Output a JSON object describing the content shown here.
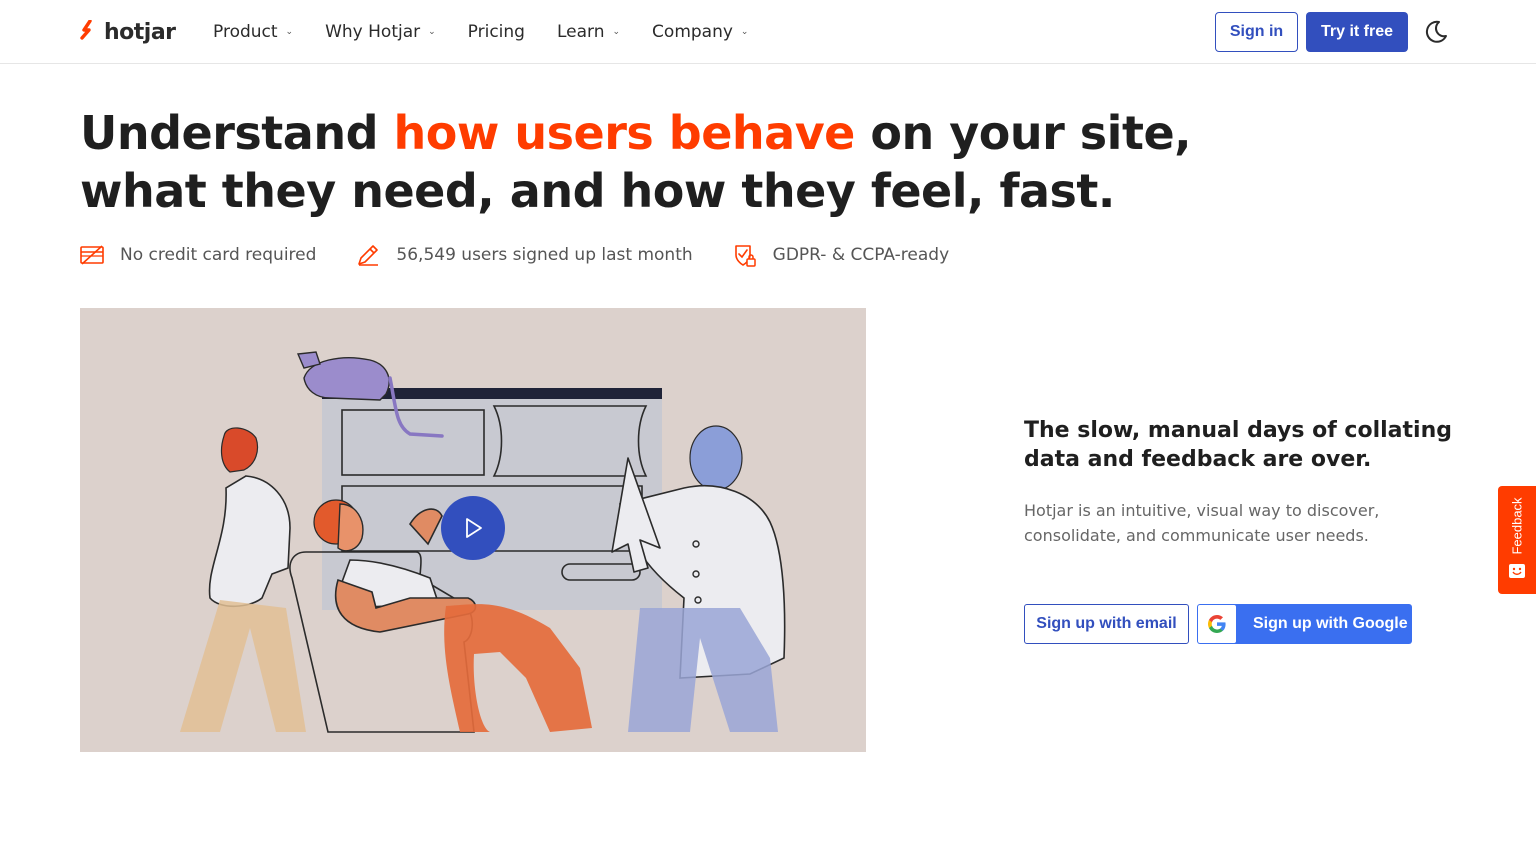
{
  "brand": {
    "name": "hotjar",
    "accent": "#ff3c00",
    "primary": "#324fbe"
  },
  "nav": {
    "items": [
      {
        "label": "Product",
        "has_dropdown": true
      },
      {
        "label": "Why Hotjar",
        "has_dropdown": true
      },
      {
        "label": "Pricing",
        "has_dropdown": false
      },
      {
        "label": "Learn",
        "has_dropdown": true
      },
      {
        "label": "Company",
        "has_dropdown": true
      }
    ],
    "sign_in": "Sign in",
    "try_free": "Try it free",
    "theme_icon": "moon-icon"
  },
  "hero": {
    "title_before": "Understand ",
    "title_accent": "how users behave",
    "title_after": " on your site, what they need, and how they feel, fast.",
    "benefits": [
      {
        "icon": "credit-card-icon",
        "text": "No credit card required"
      },
      {
        "icon": "pencil-icon",
        "text": "56,549 users signed up last month"
      },
      {
        "icon": "shield-lock-icon",
        "text": "GDPR- & CCPA-ready"
      }
    ]
  },
  "video": {
    "play_icon": "play-icon",
    "background": "#dcd1cc"
  },
  "side": {
    "title": "The slow, manual days of collating data and feedback are over.",
    "description": "Hotjar is an intuitive, visual way to discover, consolidate, and communicate user needs.",
    "signup_email": "Sign up with email",
    "signup_google": "Sign up with Google"
  },
  "feedback_tab": {
    "label": "Feedback"
  }
}
